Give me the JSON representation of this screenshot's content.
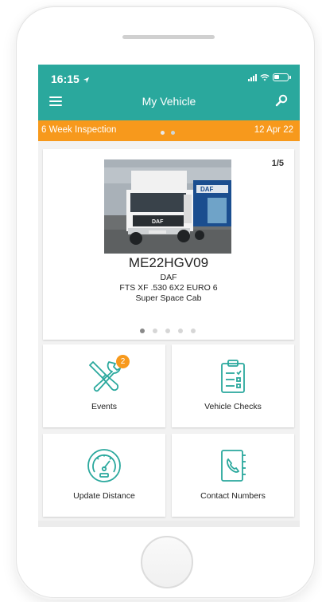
{
  "status_bar": {
    "time": "16:15"
  },
  "header": {
    "title": "My Vehicle"
  },
  "inspection": {
    "label": "6 Week Inspection",
    "date": "12 Apr 22"
  },
  "vehicle": {
    "counter": "1/5",
    "registration": "ME22HGV09",
    "make": "DAF",
    "model": "FTS XF .530 6X2 EURO 6",
    "cab": "Super Space Cab",
    "photo_brand": "DAF",
    "photo_caption": "DAF"
  },
  "tiles": [
    {
      "label": "Events",
      "badge": "2"
    },
    {
      "label": "Vehicle Checks"
    },
    {
      "label": "Update Distance"
    },
    {
      "label": "Contact Numbers"
    }
  ],
  "colors": {
    "primary": "#2aa89d",
    "accent": "#f7991c"
  }
}
